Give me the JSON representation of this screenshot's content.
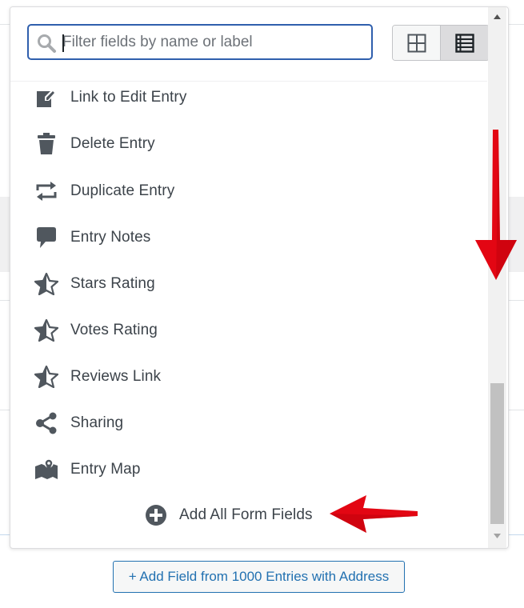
{
  "search": {
    "placeholder": "Filter fields by name or label",
    "value": ""
  },
  "view_toggle": {
    "options": [
      "grid-view",
      "list-view"
    ],
    "selected": "list-view"
  },
  "fields": [
    {
      "label": "Link to Edit Entry",
      "icon": "edit-icon"
    },
    {
      "label": "Delete Entry",
      "icon": "trash-icon"
    },
    {
      "label": "Duplicate Entry",
      "icon": "duplicate-icon"
    },
    {
      "label": "Entry Notes",
      "icon": "speech-bubble-icon"
    },
    {
      "label": "Stars Rating",
      "icon": "half-star-icon"
    },
    {
      "label": "Votes Rating",
      "icon": "half-star-icon"
    },
    {
      "label": "Reviews Link",
      "icon": "half-star-icon"
    },
    {
      "label": "Sharing",
      "icon": "share-icon"
    },
    {
      "label": "Entry Map",
      "icon": "map-icon"
    }
  ],
  "add_all": {
    "label": "Add All Form Fields",
    "icon": "plus-circle-icon"
  },
  "bottom_button": {
    "label": "+ Add Field from 1000 Entries with Address"
  },
  "colors": {
    "accent": "#2271b1",
    "search_border": "#2f5fad",
    "icon": "#50575e",
    "text": "#3c434a",
    "annotation_arrow": "#e30613"
  }
}
